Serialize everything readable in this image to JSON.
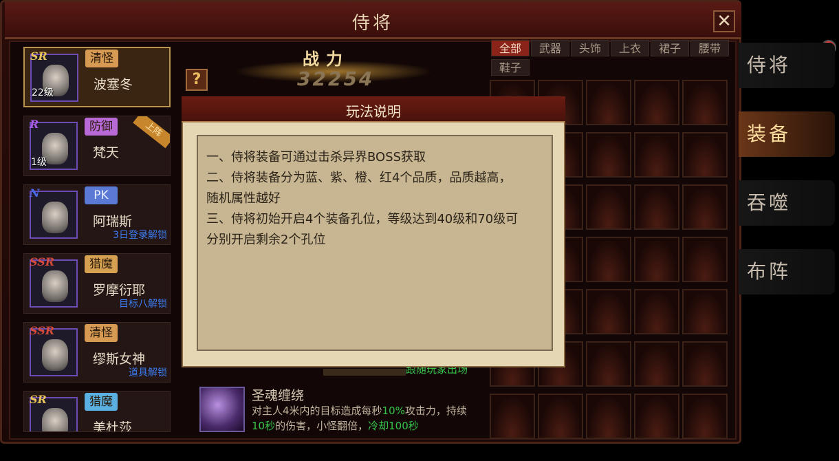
{
  "window": {
    "title": "侍将",
    "close_label": "✕"
  },
  "heroes": [
    {
      "rarity": "SR",
      "rarity_color": "#e8c45a",
      "level": "22级",
      "tag": "清怪",
      "tag_color": "#d69a52",
      "name": "波塞冬",
      "unlock": "",
      "ribbon": ""
    },
    {
      "rarity": "R",
      "rarity_color": "#a85ae8",
      "level": "1级",
      "tag": "防御",
      "tag_color": "#b76ad6",
      "name": "梵天",
      "unlock": "",
      "ribbon": "上阵"
    },
    {
      "rarity": "N",
      "rarity_color": "#4a6ae8",
      "level": "",
      "tag": "PK",
      "tag_color": "#5a7ad6",
      "name": "阿瑞斯",
      "unlock": "3日登录解锁",
      "ribbon": ""
    },
    {
      "rarity": "SSR",
      "rarity_color": "#d64a3a",
      "level": "",
      "tag": "猎魔",
      "tag_color": "#d6a252",
      "name": "罗摩衍耶",
      "unlock": "目标八解锁",
      "ribbon": ""
    },
    {
      "rarity": "SSR",
      "rarity_color": "#d64a3a",
      "level": "",
      "tag": "清怪",
      "tag_color": "#d69a52",
      "name": "缪斯女神",
      "unlock": "道具解锁",
      "ribbon": ""
    },
    {
      "rarity": "SR",
      "rarity_color": "#e8c45a",
      "level": "",
      "tag": "猎魔",
      "tag_color": "#5ab0e0",
      "name": "美杜莎",
      "unlock": "",
      "ribbon": ""
    }
  ],
  "center": {
    "power_label": "战力",
    "power_value": "32254",
    "help_label": "?",
    "hidden_text": "跟随玩家出场",
    "skill": {
      "name": "圣魂缠绕",
      "desc_parts": [
        "对主人4米内的目标造成每秒",
        "10%",
        "攻击力，持续",
        "10秒",
        "的伤害，小怪翻倍，",
        "冷却100秒"
      ]
    }
  },
  "filters": [
    "全部",
    "武器",
    "头饰",
    "上衣",
    "裙子",
    "腰带",
    "鞋子"
  ],
  "side_tabs": [
    "侍将",
    "装备",
    "吞噬",
    "布阵"
  ],
  "active_side_tab": "装备",
  "modal": {
    "title": "玩法说明",
    "lines": [
      "一、侍将装备可通过击杀异界BOSS获取",
      "二、侍将装备分为蓝、紫、橙、红4个品质，品质越高，",
      "随机属性越好",
      "三、侍将初始开启4个装备孔位，等级达到40级和70级可",
      "分别开启剩余2个孔位"
    ]
  }
}
